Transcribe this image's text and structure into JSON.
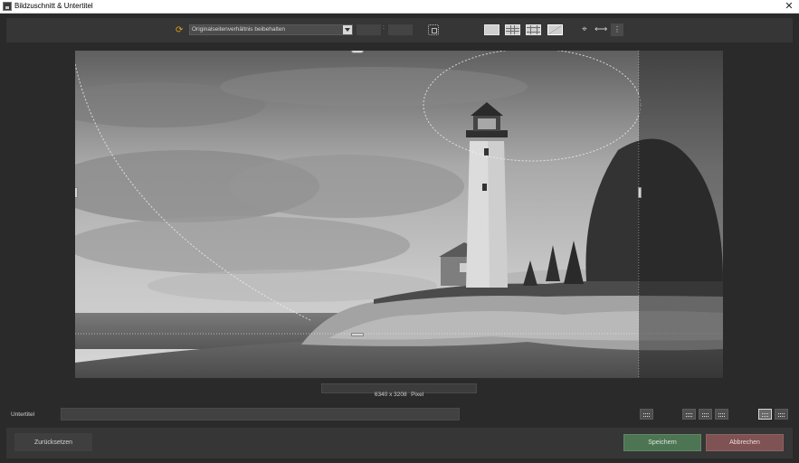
{
  "window": {
    "title": "Bildzuschnitt & Untertitel",
    "close_glyph": "✕"
  },
  "toolbar": {
    "ratio_icon": "refresh-arrows-icon",
    "ratio_icon_color": "#e0a11b",
    "aspect_ratio_select": "Originalseitenverhältnis beibehalten",
    "ratio_width": "",
    "ratio_height": "",
    "ratio_separator": ":",
    "fit_icon": "fit-to-frame-icon",
    "view_modes": [
      "no-grid",
      "grid-thirds",
      "grid-ninths",
      "grid-diagonal"
    ],
    "active_view_mode": "grid-diagonal",
    "crosshair_glyph": "⌖",
    "flip_glyph": "⟷",
    "more_glyph": "⋮"
  },
  "image": {
    "dimensions_label": "6340 x 3208",
    "unit_label": "Pixel"
  },
  "subtitle": {
    "label": "Untertitel",
    "value": "",
    "position_buttons": [
      "top-center",
      "bottom-left",
      "bottom-center",
      "bottom-right",
      "inside-bottom",
      "inside-top"
    ],
    "active_position": "inside-bottom"
  },
  "footer": {
    "reset_label": "Zurücksetzen",
    "save_label": "Speichern",
    "cancel_label": "Abbrechen",
    "save_color": "#4e7553",
    "cancel_color": "#7f5253"
  }
}
